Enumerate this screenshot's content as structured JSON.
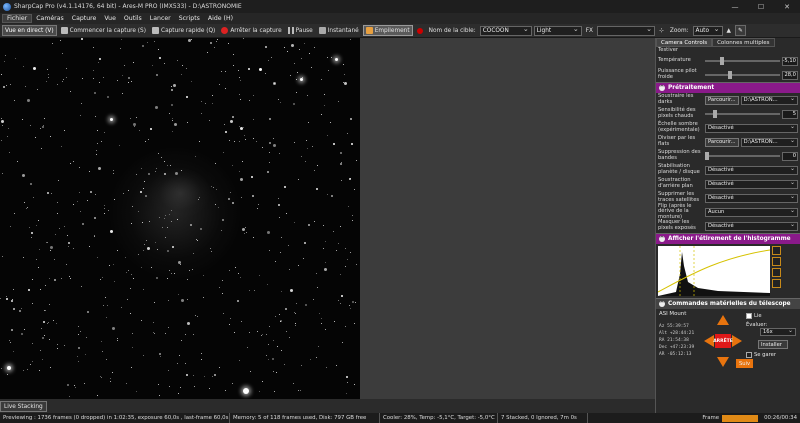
{
  "window": {
    "title": "SharpCap Pro (v4.1.14176, 64 bit) - Ares-M PRO (IMX533) - D:\\ASTRONOMIE",
    "minimize": "—",
    "maximize": "☐",
    "close": "✕"
  },
  "menu": [
    "Fichier",
    "Caméras",
    "Capture",
    "Vue",
    "Outils",
    "Lancer",
    "Scripts",
    "Aide (H)"
  ],
  "toolbar": {
    "live_view": "Vue en direct (V)",
    "start_capture": "Commencer la capture (S)",
    "quick_capture": "Capture rapide (Q)",
    "stop_capture": "Arrêter la capture",
    "pause": "Pause",
    "snapshot": "Instantané",
    "stacking": "Empilement",
    "target_label": "Nom de la cible:",
    "target_value": "COCOON",
    "profile_value": "Light",
    "fx_label": "FX",
    "zoom_label": "Zoom:",
    "zoom_value": "Auto"
  },
  "left_tab": "Live Stacking",
  "status": {
    "previewing": "Previewing : 1736 frames (0 dropped) in 1:02:35, exposure 60,0s , last-frame 60,0s",
    "memory": "Memory: 5 of 118 frames used, Disk: 797 GB free",
    "cooler": "Cooler: 28%, Temp: -5,1°C, Target: -5,0°C",
    "stacked": "7 Stacked, 0 Ignored, 7m 0s",
    "frame_label": "Frame",
    "time": "00:26/00:34"
  },
  "panel": {
    "tab_controls": "Camera Controls",
    "tab_multi": "Colonnes multiples",
    "cut_label": "Testiver",
    "temp_label": "Température",
    "temp_value": "-5,10",
    "cooler_power_label": "Puissance pilot froide",
    "cooler_power_value": "28,0",
    "preprocessing_title": "Prétraitement",
    "subtract_darks_label": "Soustraire les darks",
    "browse1": "Parcourir...",
    "path1": "D:\\ASTRON...",
    "hot_pixels_label": "Sensibilité des pixels chauds",
    "hot_pixels_value": "5",
    "dark_scale_label": "Échelle sombre (expérimentale)",
    "dark_scale_value": "Désactivé",
    "flats_label": "Diviser par les flats",
    "browse2": "Parcourir...",
    "path2": "D:\\ASTRON...",
    "banding_label": "Suppression des bandes",
    "banding_value": "0",
    "stabilization_label": "Stabilisation planète / disque",
    "stabilization_value": "Désactivé",
    "background_label": "Soustraction d'arrière plan",
    "background_value": "Désactivé",
    "satellite_label": "Supprimer les traces satellites",
    "satellite_value": "Désactivé",
    "flip_label": "Flip (après le dérive de la monture)",
    "flip_value": "Aucun",
    "mask_label": "Masquer les pixels exposés",
    "mask_value": "Désactivé",
    "histogram_title": "Afficher l'étirement de l'histogramme",
    "telescope_title": "Commandes matérielles du télescope",
    "mount_label": "ASI Mount",
    "mount_check": "Lie",
    "ra_lines": [
      "Az   55:39:57",
      "Alt  +28:44:21",
      "RA   21:54:38",
      "Dec  +47:23:39",
      "AR   -05:12:13"
    ],
    "stop_label": "ARRÊTE",
    "evaluate_label": "Évaluer:",
    "evaluate_value": "16x",
    "install_btn": "Installer",
    "park_label": "Se garer",
    "follow_btn": "Suiv"
  }
}
